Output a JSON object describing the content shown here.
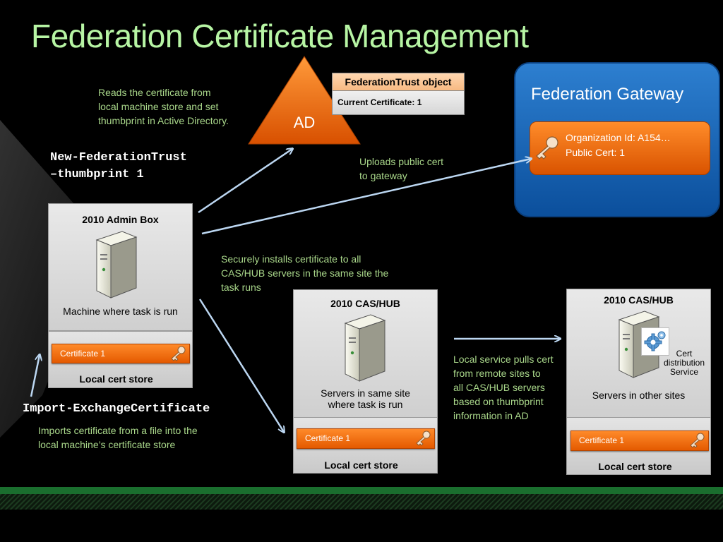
{
  "title": "Federation Certificate Management",
  "ad": {
    "label": "AD"
  },
  "federation_trust": {
    "header": "FederationTrust object",
    "current_cert": "Current Certificate: 1"
  },
  "gateway": {
    "title": "Federation Gateway",
    "org_id": "Organization Id: A154…",
    "public_cert": "Public Cert: 1"
  },
  "notes": {
    "reads_cert": [
      "Reads the certificate from",
      "local machine store and set",
      "thumbprint in Active Directory."
    ],
    "uploads": [
      "Uploads public cert",
      "to gateway"
    ],
    "installs": [
      "Securely  installs certificate to all",
      "CAS/HUB servers in the same site the",
      "task runs"
    ],
    "pulls": [
      "Local service pulls cert",
      "from remote sites to",
      "all CAS/HUB servers",
      "based on thumbprint",
      "information in AD"
    ],
    "imports": [
      "Imports certificate from a file into the",
      "local machine’s certificate store"
    ]
  },
  "commands": {
    "new_trust": [
      "New-FederationTrust",
      "–thumbprint 1"
    ],
    "import": "Import-ExchangeCertificate"
  },
  "admin_box": {
    "title": "2010 Admin Box",
    "caption": "Machine where task is run",
    "cert": "Certificate 1",
    "store": "Local cert store"
  },
  "cas_same": {
    "title": "2010 CAS/HUB",
    "caption": [
      "Servers in same site",
      "where task is run"
    ],
    "cert": "Certificate 1",
    "store": "Local cert store"
  },
  "cas_other": {
    "title": "2010 CAS/HUB",
    "caption": "Servers in other sites",
    "service": [
      "Cert",
      "distribution",
      "Service"
    ],
    "cert": "Certificate 1",
    "store": "Local cert store"
  },
  "colors": {
    "note_green": "#a9d78a",
    "title_green": "#b7f5a4",
    "orange": "#e45a00",
    "gateway_blue": "#1565b8",
    "arrow": "#bcd7f2"
  },
  "icons": [
    "server-icon",
    "key-icon",
    "gear-icon"
  ]
}
